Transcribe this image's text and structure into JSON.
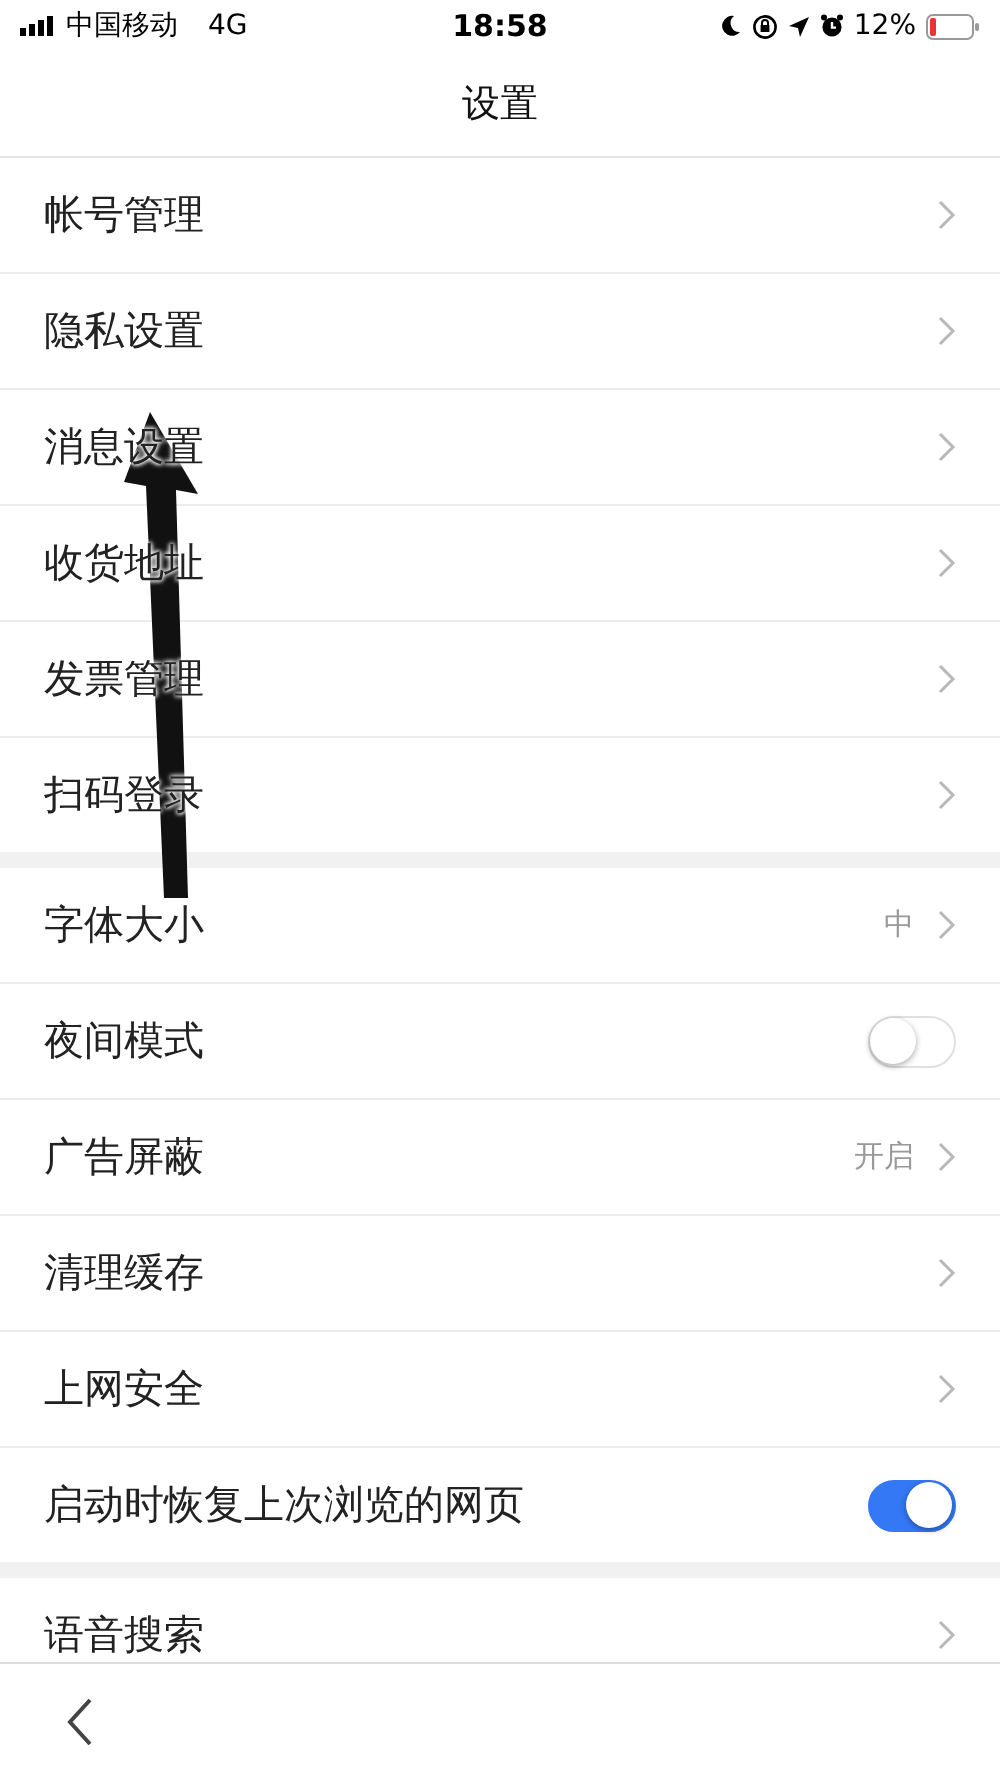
{
  "status_bar": {
    "carrier": "中国移动",
    "network": "4G",
    "time": "18:58",
    "battery": "12%"
  },
  "header": {
    "title": "设置"
  },
  "groups": [
    {
      "rows": [
        {
          "kind": "link",
          "label": "帐号管理"
        },
        {
          "kind": "link",
          "label": "隐私设置"
        },
        {
          "kind": "link",
          "label": "消息设置"
        },
        {
          "kind": "link",
          "label": "收货地址"
        },
        {
          "kind": "link",
          "label": "发票管理"
        },
        {
          "kind": "link",
          "label": "扫码登录"
        }
      ]
    },
    {
      "rows": [
        {
          "kind": "link",
          "label": "字体大小",
          "value": "中"
        },
        {
          "kind": "toggle",
          "label": "夜间模式",
          "on": false
        },
        {
          "kind": "link",
          "label": "广告屏蔽",
          "value": "开启"
        },
        {
          "kind": "link",
          "label": "清理缓存"
        },
        {
          "kind": "link",
          "label": "上网安全"
        },
        {
          "kind": "toggle",
          "label": "启动时恢复上次浏览的网页",
          "on": true
        }
      ]
    },
    {
      "rows": [
        {
          "kind": "link",
          "label": "语音搜索"
        }
      ]
    }
  ]
}
